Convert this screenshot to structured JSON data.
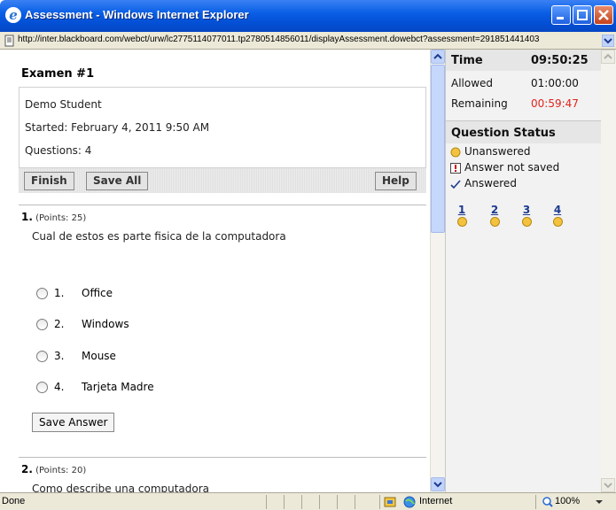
{
  "window": {
    "title": "Assessment - Windows Internet Explorer",
    "url": "http://inter.blackboard.com/webct/urw/lc2775114077011.tp2780514856011/displayAssessment.dowebct?assessment=291851441403",
    "minimize_icon": "minimize-icon",
    "maximize_icon": "maximize-icon",
    "close_icon": "close-icon"
  },
  "exam": {
    "title": "Examen #1",
    "student": "Demo Student",
    "started": "Started: February 4, 2011 9:50 AM",
    "questions": "Questions: 4"
  },
  "toolbar": {
    "finish_label": "Finish",
    "save_all_label": "Save All",
    "help_label": "Help"
  },
  "questions": [
    {
      "number": "1.",
      "points": "(Points: 25)",
      "text": "Cual de estos es parte fisica de la computadora",
      "options": [
        {
          "num": "1.",
          "label": "Office"
        },
        {
          "num": "2.",
          "label": "Windows"
        },
        {
          "num": "3.",
          "label": "Mouse"
        },
        {
          "num": "4.",
          "label": "Tarjeta Madre"
        }
      ],
      "save_label": "Save Answer"
    },
    {
      "number": "2.",
      "points": "(Points: 20)",
      "text": "Como describe una computadora"
    }
  ],
  "timer": {
    "time_label": "Time",
    "time_value": "09:50:25",
    "allowed_label": "Allowed",
    "allowed_value": "01:00:00",
    "remaining_label": "Remaining",
    "remaining_value": "00:59:47",
    "remaining_color": "#e0241b"
  },
  "status": {
    "header": "Question Status",
    "legend": [
      {
        "icon": "unanswered-circle-icon",
        "label": "Unanswered"
      },
      {
        "icon": "not-saved-warning-icon",
        "label": "Answer not saved"
      },
      {
        "icon": "checkmark-icon",
        "label": "Answered"
      }
    ],
    "question_links": [
      "1",
      "2",
      "3",
      "4"
    ]
  },
  "statusbar": {
    "left_text": "Done",
    "zone": "Internet",
    "zoom": "100%"
  }
}
